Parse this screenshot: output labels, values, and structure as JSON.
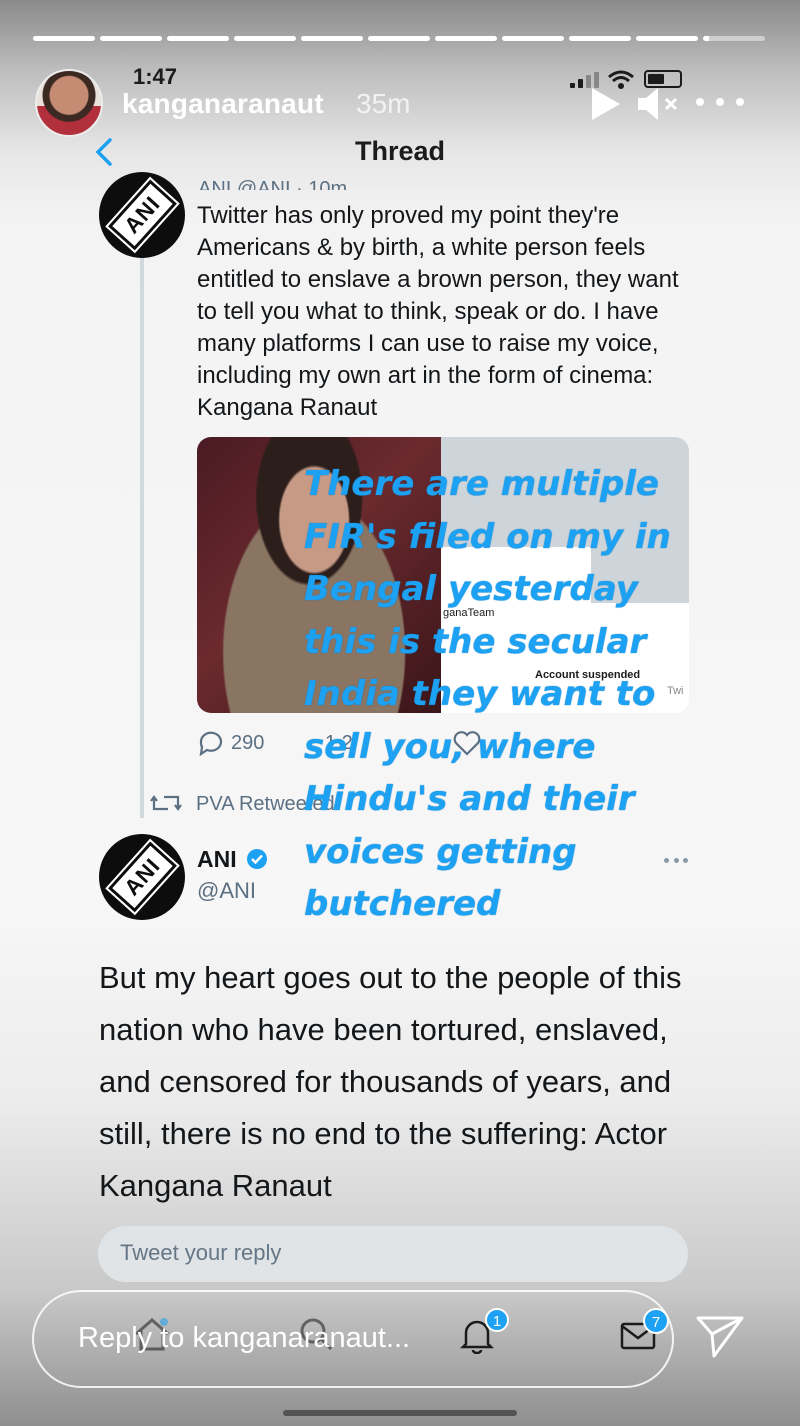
{
  "story": {
    "username": "kanganaranaut",
    "time_ago": "35m",
    "segments": [
      1,
      1,
      1,
      1,
      1,
      1,
      1,
      1,
      1,
      1,
      0.1
    ],
    "reply_placeholder": "Reply to kanganaranaut...",
    "overlay_text": "There are multiple\nFIR's filed on my in\nBengal yesterday\nthis is the secular\nIndia they want to\nsell you, where\nHindu's and their\nvoices getting\nbutchered",
    "overlay_color": "#1da1f2"
  },
  "status_bar": {
    "time": "1:47"
  },
  "twitter": {
    "header_title": "Thread",
    "quoted_tweet": {
      "author_partial": "ANI @ANI · 10m",
      "text": "Twitter has only proved my point they're Americans & by birth, a white person feels entitled to enslave a brown person, they want to tell you what to think, speak or do. I have many platforms I can use to raise my voice, including my own art in the form of cinema: Kangana Ranaut",
      "media_label_team": "ganaTeam",
      "media_label_suspended": "Account suspended",
      "media_label_partial": "Twi",
      "reply_count": "290",
      "partial_count": "1.2"
    },
    "retweet_label": "PVA Retweeted",
    "main_tweet": {
      "logo_text": "ANI",
      "name": "ANI",
      "handle": "@ANI",
      "text": "But my heart goes out to the people of this nation who have been tortured, enslaved, and censored for thousands of years, and still, there is no end to the suffering: Actor Kangana Ranaut"
    },
    "reply_box_placeholder": "Tweet your reply",
    "badges": {
      "notifications": "1",
      "messages": "7"
    },
    "accent_color": "#1da1f2"
  }
}
